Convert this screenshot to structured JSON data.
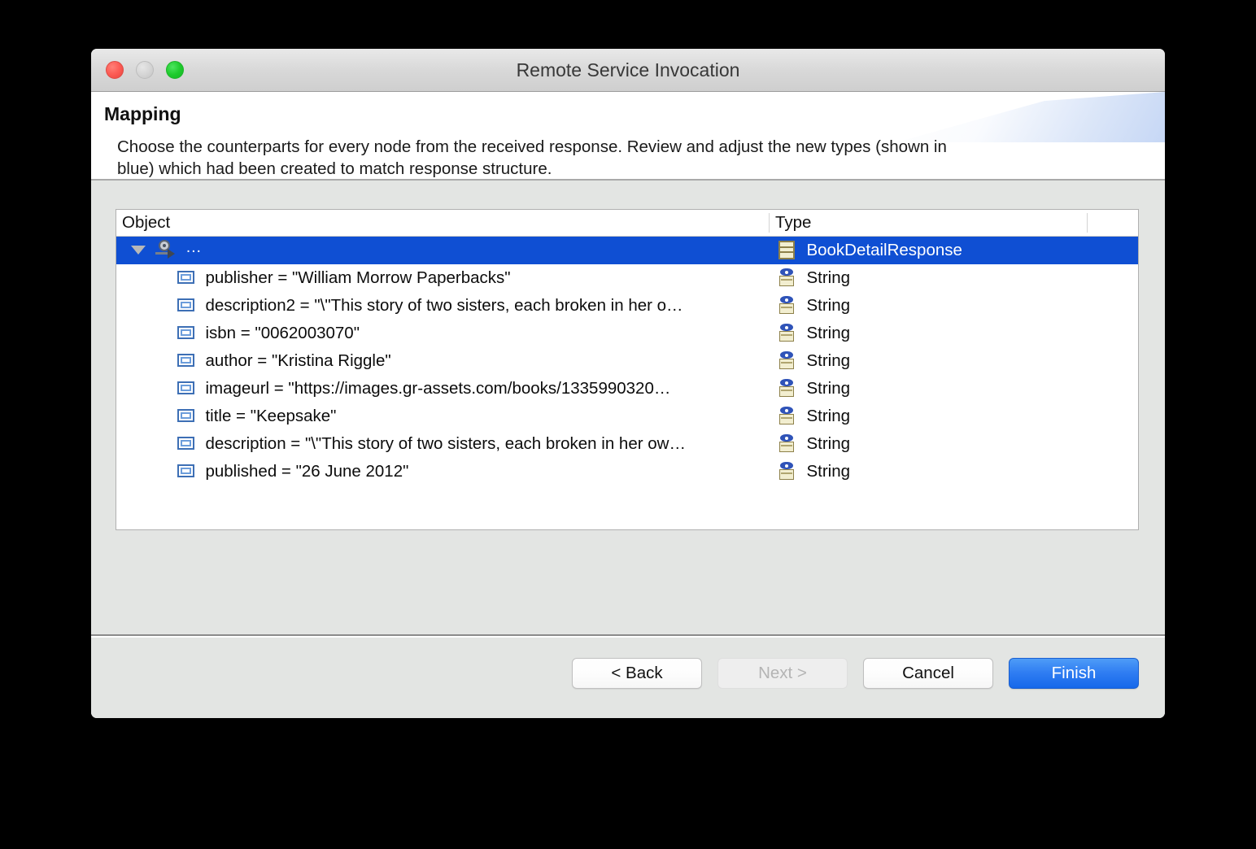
{
  "window": {
    "title": "Remote Service Invocation",
    "traffic_lights": [
      "close-light",
      "minimize-light",
      "maximize-light"
    ]
  },
  "header": {
    "page_title": "Mapping",
    "description": "Choose the counterparts for every node from the received response. Review and adjust the new types (shown in blue) which had been created to match response structure."
  },
  "table": {
    "columns": [
      {
        "label": "Object"
      },
      {
        "label": "Type"
      },
      {
        "label": ""
      }
    ],
    "rows": [
      {
        "kind": "root",
        "object": "…",
        "type": "BookDetailResponse",
        "object_icon": "invoke-gear-icon",
        "type_icon": "response-type-icon",
        "selected": true
      },
      {
        "kind": "child",
        "object": "publisher = \"William Morrow Paperbacks\"",
        "type": "String",
        "object_icon": "variable-icon",
        "type_icon": "class-type-icon",
        "selected": false
      },
      {
        "kind": "child",
        "object": "description2 = \"\\\"This story of two sisters, each broken in her o…",
        "type": "String",
        "object_icon": "variable-icon",
        "type_icon": "class-type-icon",
        "selected": false
      },
      {
        "kind": "child",
        "object": "isbn = \"0062003070\"",
        "type": "String",
        "object_icon": "variable-icon",
        "type_icon": "class-type-icon",
        "selected": false
      },
      {
        "kind": "child",
        "object": "author = \"Kristina Riggle\"",
        "type": "String",
        "object_icon": "variable-icon",
        "type_icon": "class-type-icon",
        "selected": false
      },
      {
        "kind": "child",
        "object": "imageurl = \"https://images.gr-assets.com/books/1335990320…",
        "type": "String",
        "object_icon": "variable-icon",
        "type_icon": "class-type-icon",
        "selected": false
      },
      {
        "kind": "child",
        "object": "title = \"Keepsake\"",
        "type": "String",
        "object_icon": "variable-icon",
        "type_icon": "class-type-icon",
        "selected": false
      },
      {
        "kind": "child",
        "object": "description = \"\\\"This story of two sisters, each broken in her ow…",
        "type": "String",
        "object_icon": "variable-icon",
        "type_icon": "class-type-icon",
        "selected": false
      },
      {
        "kind": "child",
        "object": "published = \"26 June 2012\"",
        "type": "String",
        "object_icon": "variable-icon",
        "type_icon": "class-type-icon",
        "selected": false
      }
    ]
  },
  "footer": {
    "buttons": [
      {
        "label": "< Back",
        "state": "normal",
        "name": "back-button"
      },
      {
        "label": "Next >",
        "state": "disabled",
        "name": "next-button"
      },
      {
        "label": "Cancel",
        "state": "normal",
        "name": "cancel-button"
      },
      {
        "label": "Finish",
        "state": "primary",
        "name": "finish-button"
      }
    ]
  },
  "colors": {
    "selection_blue": "#0f4fd3",
    "primary_button_blue": "#2f7df2",
    "new_type_blue": "#1a4fd0",
    "window_chrome": "#e3e5e3"
  }
}
